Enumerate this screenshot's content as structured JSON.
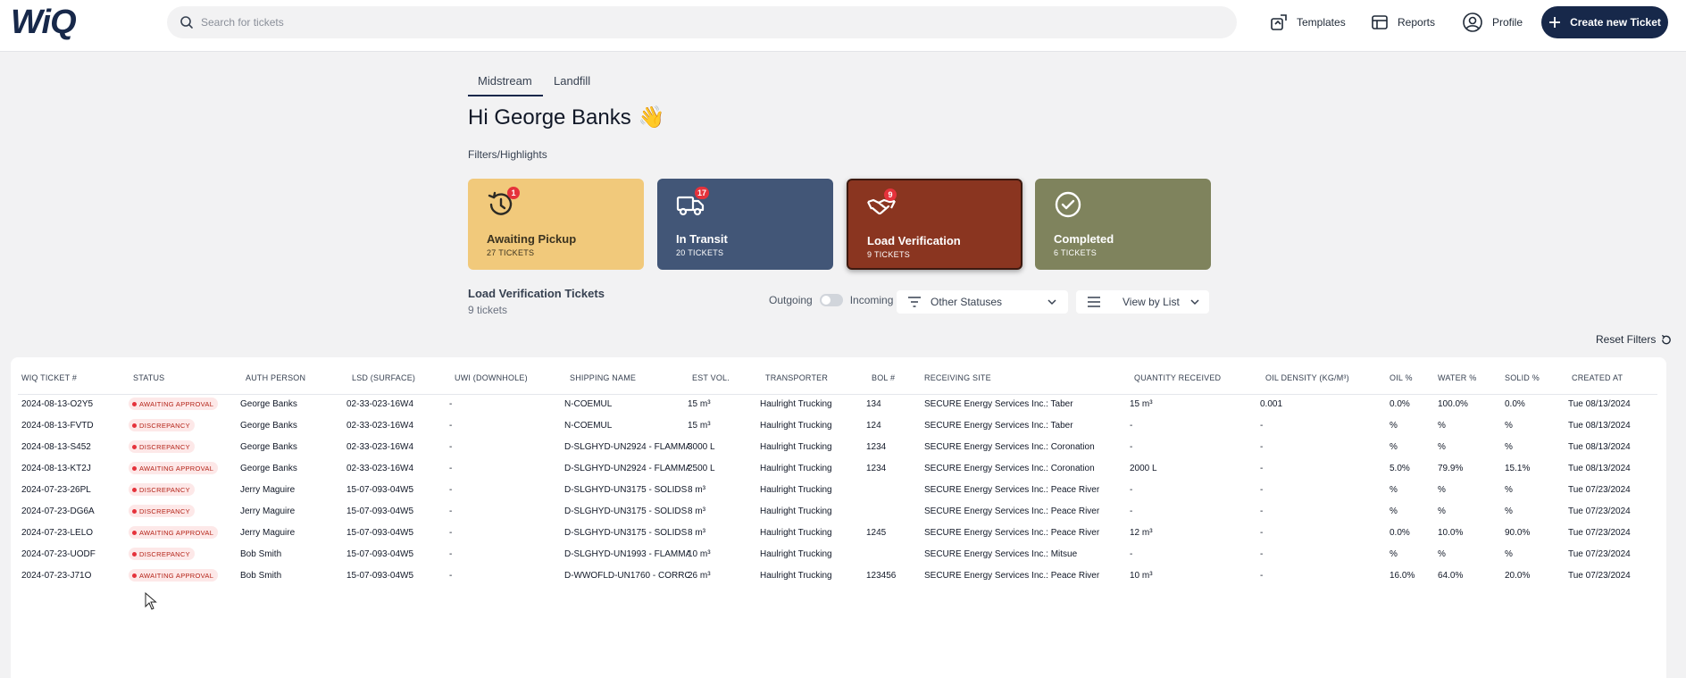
{
  "header": {
    "logo": "WiQ",
    "search_placeholder": "Search for tickets",
    "nav": [
      {
        "label": "Templates",
        "icon": "templates-icon"
      },
      {
        "label": "Reports",
        "icon": "reports-icon"
      },
      {
        "label": "Profile",
        "icon": "profile-icon"
      }
    ],
    "create_label": "Create new Ticket"
  },
  "tabs": [
    {
      "label": "Midstream",
      "active": true
    },
    {
      "label": "Landfill",
      "active": false
    }
  ],
  "greeting": "Hi George Banks",
  "greeting_emoji": "👋",
  "filters_label": "Filters/Highlights",
  "cards": [
    {
      "title": "Awaiting Pickup",
      "count": "27 TICKETS",
      "badge": "1",
      "icon": "history-icon",
      "color": "#f1c97b"
    },
    {
      "title": "In Transit",
      "count": "20 TICKETS",
      "badge": "17",
      "icon": "truck-icon",
      "color": "#425677"
    },
    {
      "title": "Load Verification",
      "count": "9 TICKETS",
      "badge": "9",
      "icon": "handshake-icon",
      "color": "#8a3520"
    },
    {
      "title": "Completed",
      "count": "6 TICKETS",
      "badge": "",
      "icon": "check-circle-icon",
      "color": "#7f835d"
    }
  ],
  "list": {
    "title": "Load Verification Tickets",
    "subtitle": "9 tickets",
    "toggle_left": "Outgoing",
    "toggle_right": "Incoming",
    "status_filter": "Other Statuses",
    "view_mode": "View by List",
    "reset_label": "Reset Filters"
  },
  "table": {
    "columns": [
      "WIQ TICKET #",
      "STATUS",
      "AUTH PERSON",
      "LSD (SURFACE)",
      "UWI (DOWNHOLE)",
      "SHIPPING NAME",
      "EST VOL.",
      "TRANSPORTER",
      "BOL #",
      "RECEIVING SITE",
      "QUANTITY RECEIVED",
      "OIL DENSITY (KG/M³)",
      "OIL %",
      "WATER %",
      "SOLID %",
      "CREATED AT"
    ],
    "rows": [
      [
        "2024-08-13-O2Y5",
        "AWAITING APPROVAL",
        "George Banks",
        "02-33-023-16W4",
        "-",
        "N-COEMUL",
        "15 m³",
        "Haulright Trucking",
        "134",
        "SECURE Energy Services Inc.: Taber",
        "15 m³",
        "0.001",
        "0.0%",
        "100.0%",
        "0.0%",
        "Tue 08/13/2024"
      ],
      [
        "2024-08-13-FVTD",
        "DISCREPANCY",
        "George Banks",
        "02-33-023-16W4",
        "-",
        "N-COEMUL",
        "15 m³",
        "Haulright Trucking",
        "124",
        "SECURE Energy Services Inc.: Taber",
        "-",
        "-",
        "%",
        "%",
        "%",
        "Tue 08/13/2024"
      ],
      [
        "2024-08-13-S452",
        "DISCREPANCY",
        "George Banks",
        "02-33-023-16W4",
        "-",
        "D-SLGHYD-UN2924 - FLAMMA",
        "3000 L",
        "Haulright Trucking",
        "1234",
        "SECURE Energy Services Inc.: Coronation",
        "-",
        "-",
        "%",
        "%",
        "%",
        "Tue 08/13/2024"
      ],
      [
        "2024-08-13-KT2J",
        "AWAITING APPROVAL",
        "George Banks",
        "02-33-023-16W4",
        "-",
        "D-SLGHYD-UN2924 - FLAMMA",
        "2500 L",
        "Haulright Trucking",
        "1234",
        "SECURE Energy Services Inc.: Coronation",
        "2000 L",
        "-",
        "5.0%",
        "79.9%",
        "15.1%",
        "Tue 08/13/2024"
      ],
      [
        "2024-07-23-26PL",
        "DISCREPANCY",
        "Jerry Maguire",
        "15-07-093-04W5",
        "-",
        "D-SLGHYD-UN3175 - SOLIDS",
        "8 m³",
        "Haulright Trucking",
        "",
        "SECURE Energy Services Inc.: Peace River",
        "-",
        "-",
        "%",
        "%",
        "%",
        "Tue 07/23/2024"
      ],
      [
        "2024-07-23-DG6A",
        "DISCREPANCY",
        "Jerry Maguire",
        "15-07-093-04W5",
        "-",
        "D-SLGHYD-UN3175 - SOLIDS",
        "8 m³",
        "Haulright Trucking",
        "",
        "SECURE Energy Services Inc.: Peace River",
        "-",
        "-",
        "%",
        "%",
        "%",
        "Tue 07/23/2024"
      ],
      [
        "2024-07-23-LELO",
        "AWAITING APPROVAL",
        "Jerry Maguire",
        "15-07-093-04W5",
        "-",
        "D-SLGHYD-UN3175 - SOLIDS",
        "8 m³",
        "Haulright Trucking",
        "1245",
        "SECURE Energy Services Inc.: Peace River",
        "12 m³",
        "-",
        "0.0%",
        "10.0%",
        "90.0%",
        "Tue 07/23/2024"
      ],
      [
        "2024-07-23-UODF",
        "DISCREPANCY",
        "Bob Smith",
        "15-07-093-04W5",
        "-",
        "D-SLGHYD-UN1993 - FLAMMA",
        "10 m³",
        "Haulright Trucking",
        "",
        "SECURE Energy Services Inc.: Mitsue",
        "-",
        "-",
        "%",
        "%",
        "%",
        "Tue 07/23/2024"
      ],
      [
        "2024-07-23-J71O",
        "AWAITING APPROVAL",
        "Bob Smith",
        "15-07-093-04W5",
        "-",
        "D-WWOFLD-UN1760 - CORROS",
        "26 m³",
        "Haulright Trucking",
        "123456",
        "SECURE Energy Services Inc.: Peace River",
        "10 m³",
        "-",
        "16.0%",
        "64.0%",
        "20.0%",
        "Tue 07/23/2024"
      ]
    ]
  }
}
